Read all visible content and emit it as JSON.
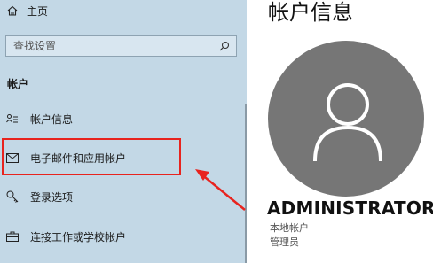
{
  "sidebar": {
    "home_label": "主页",
    "search_placeholder": "查找设置",
    "section_title": "帐户",
    "items": [
      {
        "label": "帐户信息",
        "icon": "person-list-icon"
      },
      {
        "label": "电子邮件和应用帐户",
        "icon": "mail-icon"
      },
      {
        "label": "登录选项",
        "icon": "key-icon"
      },
      {
        "label": "连接工作或学校帐户",
        "icon": "briefcase-icon"
      }
    ]
  },
  "main": {
    "title": "帐户信息",
    "user_name": "ADMINISTRATOR",
    "account_type": "本地帐户",
    "role": "管理员"
  },
  "colors": {
    "sidebar_bg": "#c3d8e6",
    "highlight": "#e8231e",
    "avatar_bg": "#767676"
  }
}
